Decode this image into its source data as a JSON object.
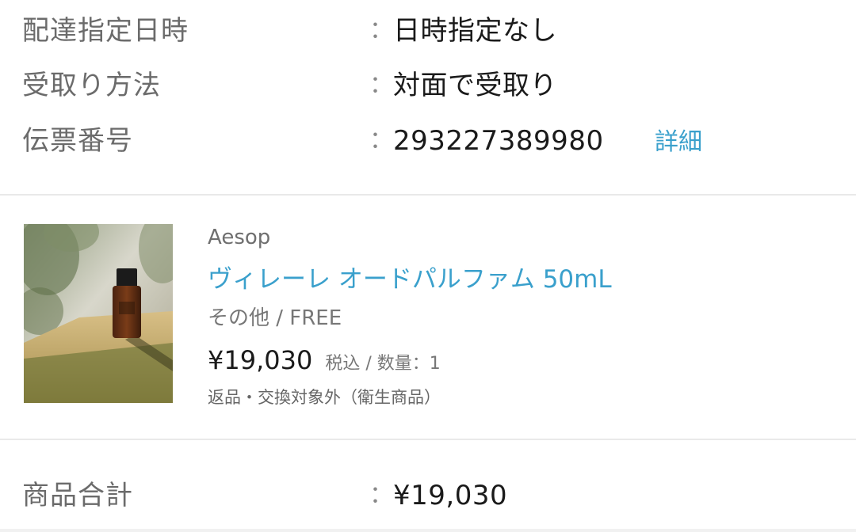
{
  "delivery": {
    "datetime_label": "配達指定日時",
    "datetime_value": "日時指定なし",
    "method_label": "受取り方法",
    "method_value": "対面で受取り",
    "tracking_label": "伝票番号",
    "tracking_value": "293227389980",
    "tracking_detail_link": "詳細",
    "colon": "："
  },
  "product": {
    "brand": "Aesop",
    "name": "ヴィレーレ オードパルファム 50mL",
    "variant": "その他 / FREE",
    "price": "¥19,030",
    "tax_quantity": "税込 / 数量：1",
    "return_note": "返品・交換対象外（衛生商品）",
    "image_icon": "perfume-bottle-photo"
  },
  "summary": {
    "subtotal_label": "商品合計",
    "subtotal_value": "¥19,030"
  },
  "colors": {
    "link": "#3aa0cc",
    "label": "#6b6b6b",
    "divider": "#e9e9e9"
  }
}
